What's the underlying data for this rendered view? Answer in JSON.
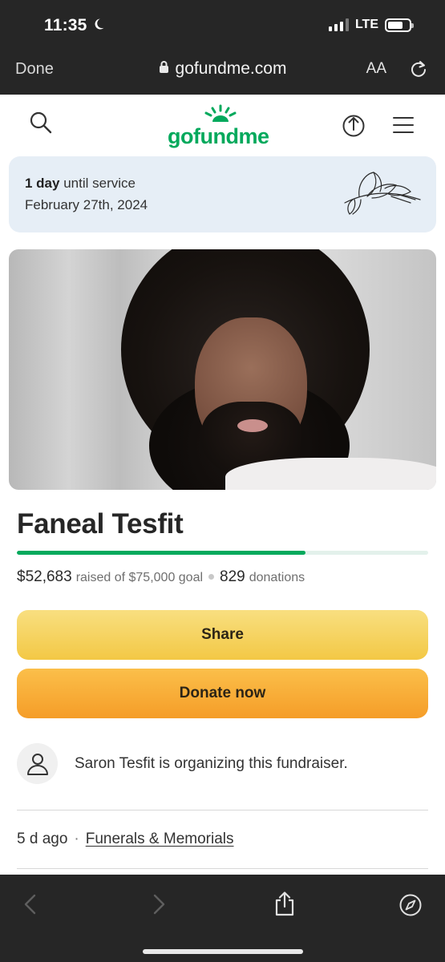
{
  "status_bar": {
    "time": "11:35",
    "network": "LTE"
  },
  "browser": {
    "done_label": "Done",
    "url": "gofundme.com",
    "aa_label": "AA"
  },
  "site": {
    "logo_text": "gofundme",
    "brand_color": "#02a95c"
  },
  "service": {
    "days": "1 day",
    "until_text": "until service",
    "date": "February 27th, 2024"
  },
  "fundraiser": {
    "title": "Faneal Tesfit",
    "raised": "$52,683",
    "raised_of_text": "raised of $75,000 goal",
    "donations_count": "829",
    "donations_label": "donations",
    "progress_fraction": 0.7024
  },
  "buttons": {
    "share_label": "Share",
    "donate_label": "Donate now"
  },
  "organizer": {
    "text": "Saron Tesfit is organizing this fundraiser."
  },
  "meta": {
    "age": "5 d ago",
    "separator": "·",
    "category": "Funerals & Memorials"
  },
  "colors": {
    "share_yellow": "#f3c845",
    "donate_orange": "#f59d28",
    "chrome_dark": "#262626",
    "service_bg": "#e6eef6"
  }
}
